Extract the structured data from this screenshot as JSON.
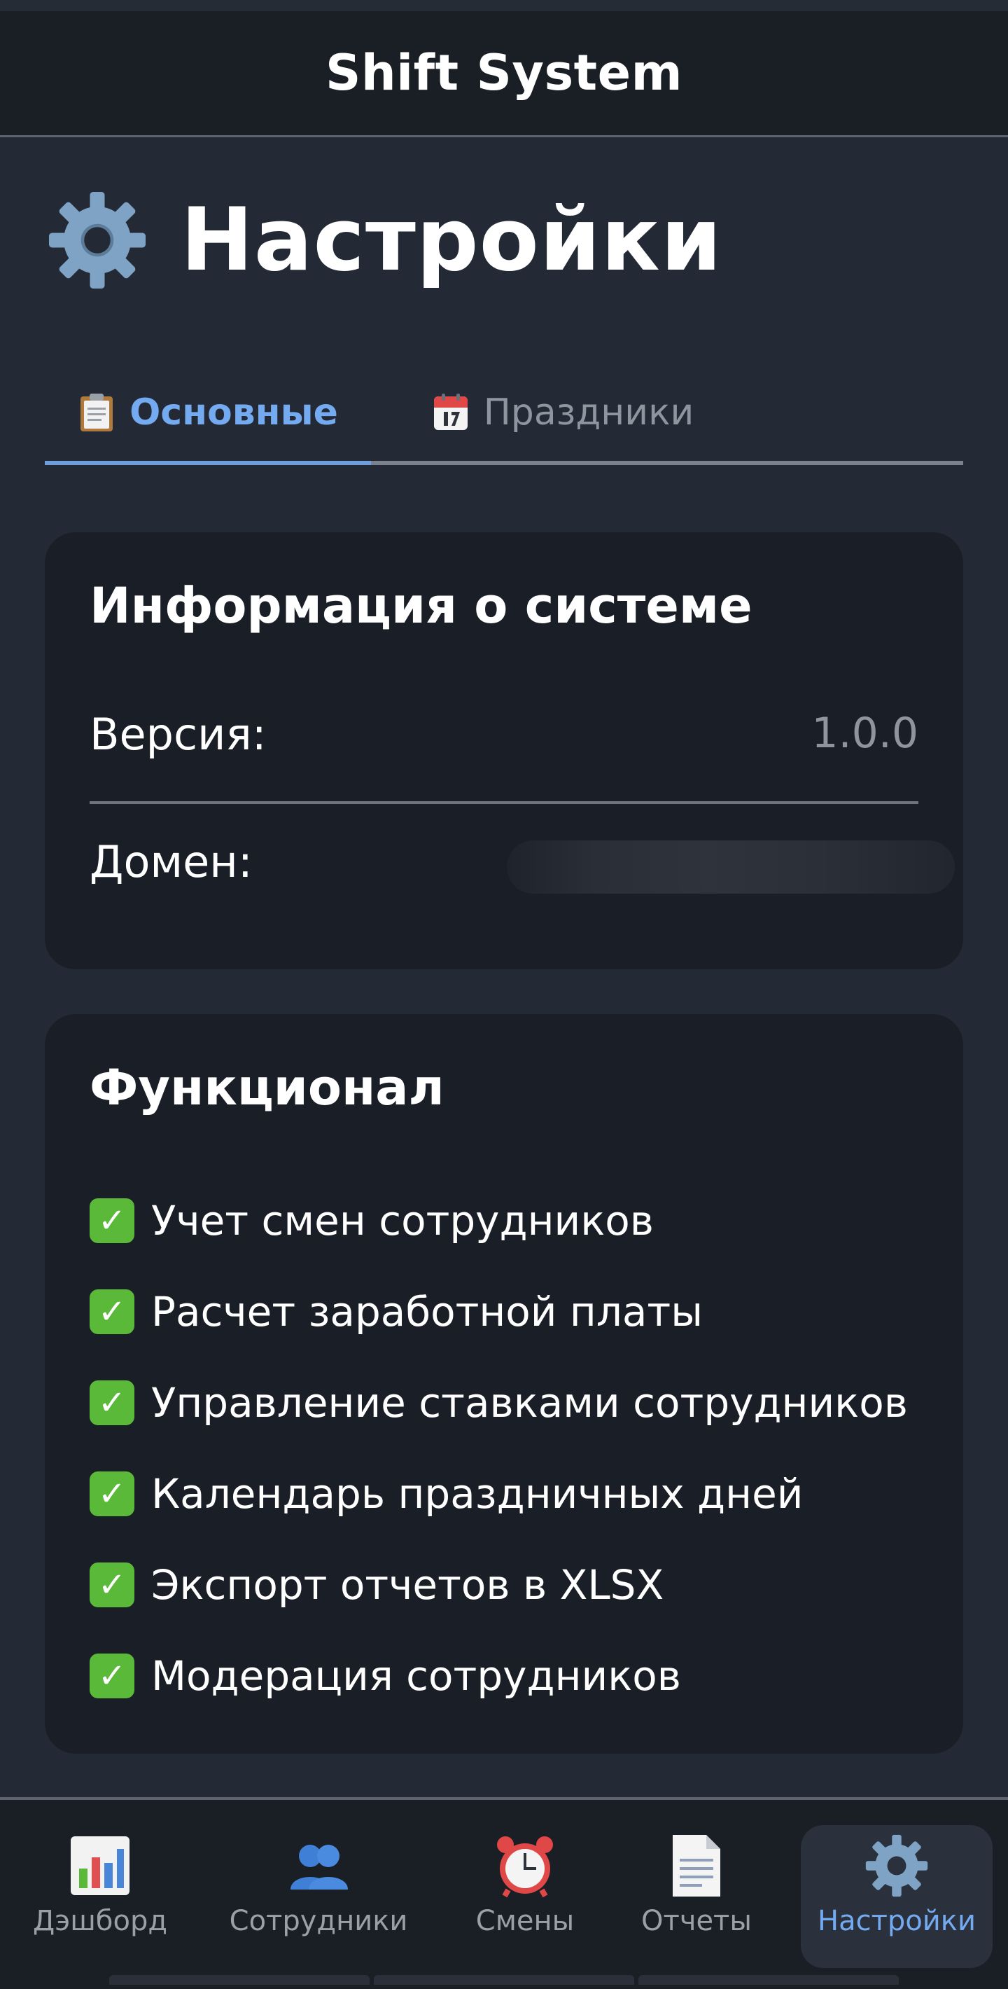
{
  "app": {
    "title": "Shift System"
  },
  "page": {
    "title": "Настройки",
    "icon": "gear-icon"
  },
  "tabs": [
    {
      "label": "Основные",
      "icon": "clipboard-icon",
      "active": true
    },
    {
      "label": "Праздники",
      "icon": "calendar-icon",
      "active": false
    }
  ],
  "system_info": {
    "title": "Информация о системе",
    "version_label": "Версия:",
    "version_value": "1.0.0",
    "domain_label": "Домен:"
  },
  "features": {
    "title": "Функционал",
    "items": [
      "Учет смен сотрудников",
      "Расчет заработной платы",
      "Управление ставками сотрудников",
      "Календарь праздничных дней",
      "Экспорт отчетов в XLSX",
      "Модерация сотрудников"
    ]
  },
  "nav": {
    "items": [
      {
        "label": "Дэшборд",
        "icon": "bar-chart-icon",
        "active": false
      },
      {
        "label": "Сотрудники",
        "icon": "users-icon",
        "active": false
      },
      {
        "label": "Смены",
        "icon": "alarm-clock-icon",
        "active": false
      },
      {
        "label": "Отчеты",
        "icon": "document-icon",
        "active": false
      },
      {
        "label": "Настройки",
        "icon": "gear-icon",
        "active": true
      }
    ]
  },
  "colors": {
    "background": "#232a36",
    "card": "#1a1e26",
    "accent": "#74aaf0",
    "muted": "#8f959e",
    "check": "#5bb93a"
  }
}
